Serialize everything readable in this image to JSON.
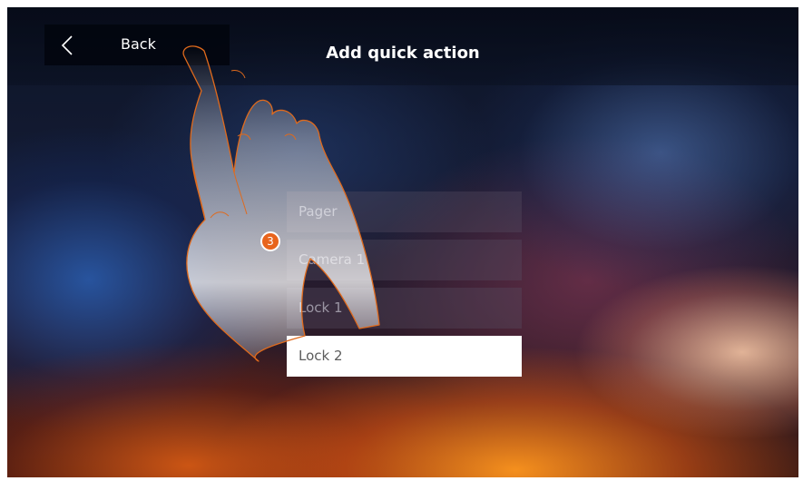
{
  "header": {
    "back_label": "Back",
    "title": "Add quick action"
  },
  "actions": [
    {
      "label": "Pager",
      "selected": false
    },
    {
      "label": "Camera 1",
      "selected": false
    },
    {
      "label": "Lock 1",
      "selected": false
    },
    {
      "label": "Lock 2",
      "selected": true
    }
  ],
  "annotation": {
    "step_number": "3",
    "gesture_icon": "pointing-hand-icon",
    "badge_color": "#e8641c",
    "hand_outline_color": "#e06a1c"
  },
  "colors": {
    "selected_item_bg": "#ffffff",
    "header_bg": "#060a16"
  }
}
